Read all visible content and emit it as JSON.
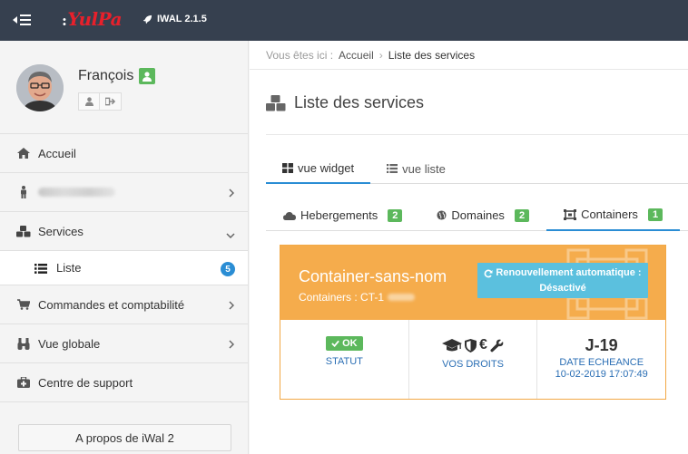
{
  "topbar": {
    "logo_text": "YulPa",
    "logo_prefix": ":",
    "version": "IWAL 2.1.5"
  },
  "sidebar": {
    "user_name": "François",
    "items": [
      {
        "label": "Accueil",
        "icon": "home-icon",
        "has_chevron": false
      },
      {
        "label": "",
        "icon": "person-icon",
        "has_chevron": true,
        "blurred": true
      },
      {
        "label": "Services",
        "icon": "cubes-icon",
        "has_chevron": true,
        "expanded": true
      },
      {
        "label": "Commandes et comptabilité",
        "icon": "cart-icon",
        "has_chevron": true
      },
      {
        "label": "Vue globale",
        "icon": "binoculars-icon",
        "has_chevron": true
      },
      {
        "label": "Centre de support",
        "icon": "medkit-icon",
        "has_chevron": false
      }
    ],
    "subitem": {
      "label": "Liste",
      "icon": "list-icon",
      "badge": "5"
    },
    "about_label": "A propos de iWal 2"
  },
  "breadcrumb": {
    "prefix": "Vous êtes ici :",
    "home": "Accueil",
    "current": "Liste des services"
  },
  "page": {
    "title": "Liste des services"
  },
  "view_tabs": [
    {
      "label": "vue widget",
      "active": true
    },
    {
      "label": "vue liste",
      "active": false
    }
  ],
  "category_tabs": [
    {
      "label": "Hebergements",
      "count": "2",
      "active": false
    },
    {
      "label": "Domaines",
      "count": "2",
      "active": false
    },
    {
      "label": "Containers",
      "count": "1",
      "active": true
    }
  ],
  "card": {
    "title": "Container-sans-nom",
    "subtitle": "Containers : CT-1",
    "renew_line1": "Renouvellement automatique :",
    "renew_line2": "Désactivé",
    "status_badge": "OK",
    "status_label": "STATUT",
    "rights_label": "VOS DROITS",
    "rights_euro": "€",
    "deadline_big": "J-19",
    "deadline_label": "DATE ECHEANCE",
    "deadline_date": "10-02-2019 17:07:49"
  },
  "colors": {
    "topbar": "#36404f",
    "accent": "#2a8dd4",
    "card_orange": "#f5ac4c",
    "info_blue": "#5bc0de",
    "success": "#5cb85c"
  }
}
